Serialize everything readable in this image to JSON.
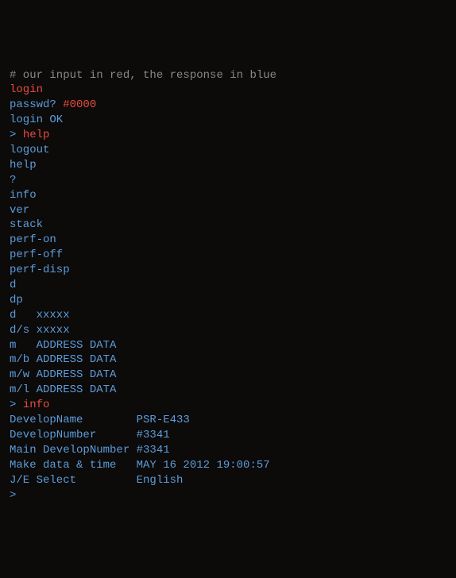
{
  "lines": [
    {
      "type": "comment",
      "text": "# our input in red, the response in blue"
    },
    {
      "type": "input",
      "text": "login"
    },
    {
      "type": "mixed",
      "parts": [
        {
          "cls": "response",
          "text": "passwd? "
        },
        {
          "cls": "input",
          "text": "#0000"
        }
      ]
    },
    {
      "type": "response",
      "text": "login OK"
    },
    {
      "type": "mixed",
      "parts": [
        {
          "cls": "prompt",
          "text": "> "
        },
        {
          "cls": "input",
          "text": "help"
        }
      ]
    },
    {
      "type": "response",
      "text": "logout"
    },
    {
      "type": "response",
      "text": "help"
    },
    {
      "type": "response",
      "text": "?"
    },
    {
      "type": "response",
      "text": "info"
    },
    {
      "type": "response",
      "text": "ver"
    },
    {
      "type": "response",
      "text": "stack"
    },
    {
      "type": "response",
      "text": "perf-on"
    },
    {
      "type": "response",
      "text": "perf-off"
    },
    {
      "type": "response",
      "text": "perf-disp"
    },
    {
      "type": "response",
      "text": "d"
    },
    {
      "type": "response",
      "text": "dp"
    },
    {
      "type": "response",
      "text": "d   xxxxx"
    },
    {
      "type": "response",
      "text": "d/s xxxxx"
    },
    {
      "type": "response",
      "text": "m   ADDRESS DATA"
    },
    {
      "type": "response",
      "text": "m/b ADDRESS DATA"
    },
    {
      "type": "response",
      "text": "m/w ADDRESS DATA"
    },
    {
      "type": "response",
      "text": "m/l ADDRESS DATA"
    },
    {
      "type": "mixed",
      "parts": [
        {
          "cls": "prompt",
          "text": "> "
        },
        {
          "cls": "input",
          "text": "info"
        }
      ]
    },
    {
      "type": "response",
      "text": "DevelopName        PSR-E433"
    },
    {
      "type": "response",
      "text": "DevelopNumber      #3341"
    },
    {
      "type": "response",
      "text": "Main DevelopNumber #3341"
    },
    {
      "type": "response",
      "text": "Make data & time   MAY 16 2012 19:00:57"
    },
    {
      "type": "response",
      "text": "J/E Select         English"
    },
    {
      "type": "prompt",
      "text": ">"
    }
  ]
}
